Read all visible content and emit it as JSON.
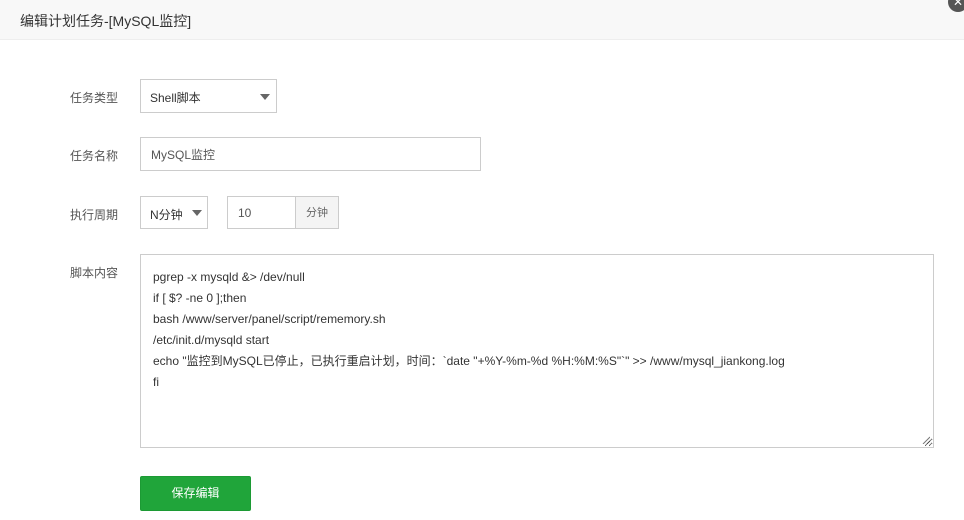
{
  "dialog": {
    "title": "编辑计划任务-[MySQL监控]",
    "close_icon": "close-icon"
  },
  "form": {
    "task_type": {
      "label": "任务类型",
      "value": "Shell脚本"
    },
    "task_name": {
      "label": "任务名称",
      "value": "MySQL监控"
    },
    "period": {
      "label": "执行周期",
      "select_value": "N分钟",
      "minutes_value": "10",
      "unit": "分钟"
    },
    "script": {
      "label": "脚本内容",
      "lines": [
        "pgrep -x mysqld &> /dev/null",
        "if [ $? -ne 0 ];then",
        "bash /www/server/panel/script/rememory.sh",
        "/etc/init.d/mysqld start",
        "echo \"监控到MySQL已停止，已执行重启计划，时间：`date \"+%Y-%m-%d %H:%M:%S\"`\" >> /www/mysql_jiankong.log",
        "fi"
      ]
    },
    "save_label": "保存编辑"
  },
  "colors": {
    "accent": "#20a53a",
    "header_bg": "#f8f8f8",
    "border": "#cccccc"
  }
}
